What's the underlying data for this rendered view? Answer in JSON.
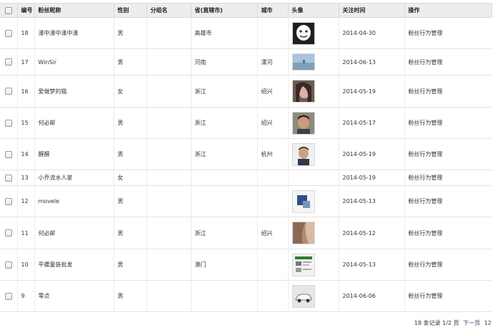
{
  "table": {
    "headers": [
      "",
      "编号",
      "粉丝昵称",
      "性别",
      "分组名",
      "省(直辖市)",
      "城市",
      "头像",
      "关注时间",
      "操作"
    ],
    "rows": [
      {
        "id": "18",
        "nickname": "漾中漾中漾中漾",
        "gender": "男",
        "group": "",
        "province": "高雄市",
        "city": "",
        "avatar": "cartoon-face-avatar",
        "follow_time": "2014-04-30",
        "action": "粉丝行为管理"
      },
      {
        "id": "17",
        "nickname": "WinSir",
        "gender": "男",
        "group": "",
        "province": "河南",
        "city": "漯河",
        "avatar": "seascape-avatar",
        "follow_time": "2014-06-13",
        "action": "粉丝行为管理"
      },
      {
        "id": "16",
        "nickname": "爱做梦的猫",
        "gender": "女",
        "group": "",
        "province": "浙江",
        "city": "绍兴",
        "avatar": "portrait-woman-avatar",
        "follow_time": "2014-05-19",
        "action": "粉丝行为管理"
      },
      {
        "id": "15",
        "nickname": "何必邮",
        "gender": "男",
        "group": "",
        "province": "浙江",
        "city": "绍兴",
        "avatar": "portrait-man-avatar",
        "follow_time": "2014-05-17",
        "action": "粉丝行为管理"
      },
      {
        "id": "14",
        "nickname": "醒醒",
        "gender": "男",
        "group": "",
        "province": "浙江",
        "city": "杭州",
        "avatar": "portrait-young-man-avatar",
        "follow_time": "2014-05-19",
        "action": "粉丝行为管理"
      },
      {
        "id": "13",
        "nickname": "小乔流水人家",
        "gender": "女",
        "group": "",
        "province": "",
        "city": "",
        "avatar": "",
        "follow_time": "2014-05-19",
        "action": "粉丝行为管理"
      },
      {
        "id": "12",
        "nickname": "movele",
        "gender": "男",
        "group": "",
        "province": "",
        "city": "",
        "avatar": "logo-avatar",
        "follow_time": "2014-05-13",
        "action": "粉丝行为管理"
      },
      {
        "id": "11",
        "nickname": "何必邮",
        "gender": "男",
        "group": "",
        "province": "浙江",
        "city": "绍兴",
        "avatar": "hair-closeup-avatar",
        "follow_time": "2014-05-12",
        "action": "粉丝行为管理"
      },
      {
        "id": "10",
        "nickname": "平蝶童装批发",
        "gender": "男",
        "group": "",
        "province": "澳门",
        "city": "",
        "avatar": "screenshot-avatar",
        "follow_time": "2014-05-13",
        "action": "粉丝行为管理"
      },
      {
        "id": "9",
        "nickname": "零点",
        "gender": "男",
        "group": "",
        "province": "",
        "city": "",
        "avatar": "car-avatar",
        "follow_time": "2014-06-06",
        "action": "粉丝行为管理"
      }
    ]
  },
  "pager": {
    "summary": "18 条记录 1/2 页",
    "next": "下一页",
    "last": "12"
  }
}
